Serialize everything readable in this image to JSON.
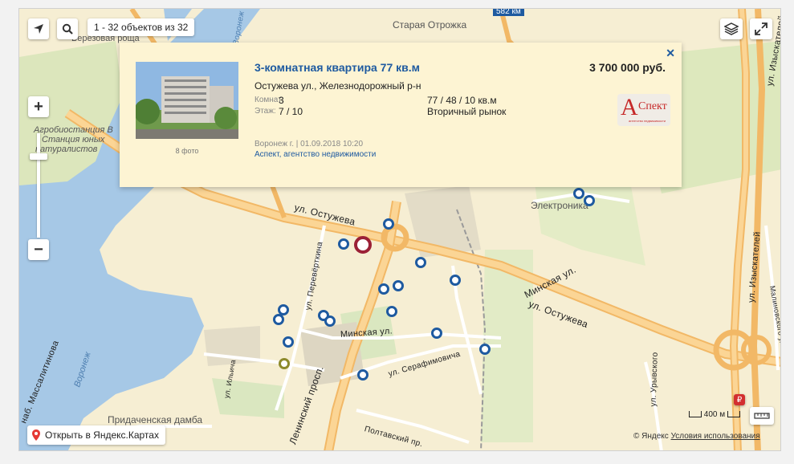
{
  "toolbar": {
    "objects_count": "1 - 32 объектов из 32",
    "locate_icon": "arrow-locate-icon",
    "search_icon": "magnifier-icon",
    "layers_icon": "layers-icon",
    "fullscreen_icon": "expand-arrows-icon",
    "zoom_in_label": "+",
    "zoom_out_label": "−",
    "ruler_icon": "ruler-icon"
  },
  "map_labels": {
    "districts": [
      "Старая Отрожка",
      "Березовая роща",
      "Электроника"
    ],
    "highway": "582 км",
    "biostation": [
      "Агробиостанция В",
      "Станция юных",
      "натуралистов"
    ],
    "river": "Воронеж",
    "dam": "Придаченская дамба"
  },
  "streets": [
    {
      "name": "ул. Остужева"
    },
    {
      "name": "ул. Остужева"
    },
    {
      "name": "Минская ул."
    },
    {
      "name": "Минская ул."
    },
    {
      "name": "ул. Перевёрткина"
    },
    {
      "name": "Ленинский просп."
    },
    {
      "name": "ул. Серафимовича"
    },
    {
      "name": "ул. Изыскателей"
    },
    {
      "name": "ул. Изыскателей"
    },
    {
      "name": "Малиновского ул."
    },
    {
      "name": "ул. Ильича"
    },
    {
      "name": "наб. Массалитинова"
    },
    {
      "name": "Полтавский пр."
    },
    {
      "name": "ул. Урывского"
    },
    {
      "name": "Воронеж"
    }
  ],
  "listing": {
    "title": "3-комнатная квартира 77 кв.м",
    "price": "3 700 000 руб.",
    "address": "Остужева ул., Железнодорожный р-н",
    "rooms_key": "Комнат:",
    "rooms_value": "3",
    "floor_key": "Этаж:",
    "floor_value": "7 / 10",
    "area": "77 / 48 / 10 кв.м",
    "market": "Вторичный рынок",
    "photo_caption": "8 фото",
    "city_date": "Воронеж г. | 01.09.2018 10:20",
    "agency": "Аспект, агентство недвижимости",
    "logo_letter": "А",
    "logo_word": "Спект",
    "logo_sub": "агентство недвижимости",
    "close_label": "✕"
  },
  "footer": {
    "open_yandex": "Открыть в Яндекс.Картах",
    "scale": "400 м",
    "copyright": "© Яндекс",
    "terms": "Условия использования"
  },
  "colors": {
    "marker_blue": "#1e5aa0",
    "marker_selected": "#9b2036",
    "marker_olive": "#8d8a2c",
    "water": "#a6c8e6",
    "roads": "#f2b866"
  }
}
